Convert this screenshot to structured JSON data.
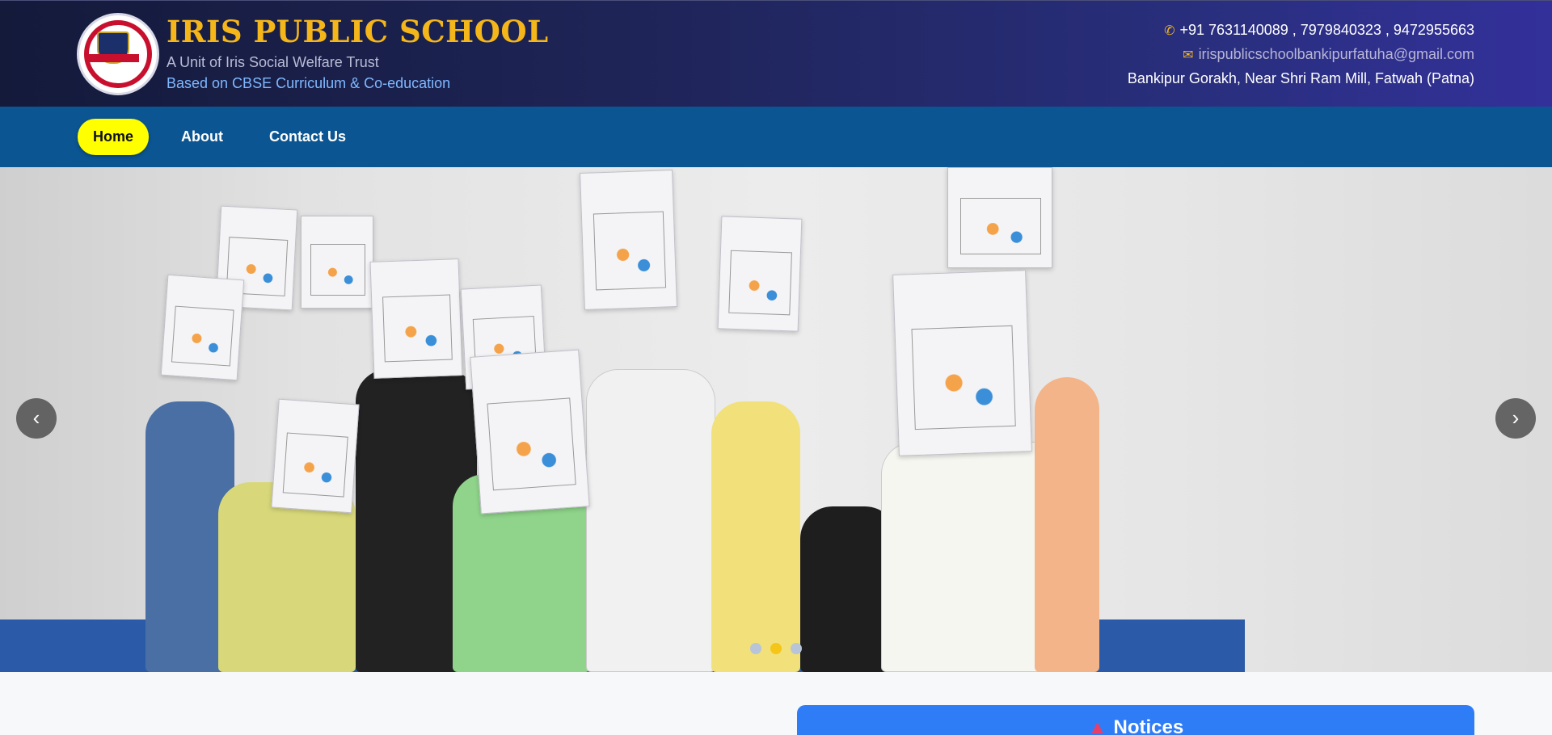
{
  "header": {
    "school_name": "IRIS PUBLIC SCHOOL",
    "subtitle1": "A Unit of Iris Social Welfare Trust",
    "subtitle2": "Based on CBSE Curriculum & Co-education",
    "phone": "+91 7631140089 , 7979840323 , 9472955663",
    "email": "irispublicschoolbankipurfatuha@gmail.com",
    "address": "Bankipur Gorakh, Near Shri Ram Mill, Fatwah (Patna)",
    "phone_icon": "phone-icon",
    "email_icon": "mail-icon"
  },
  "nav": {
    "items": [
      {
        "label": "Home",
        "active": true
      },
      {
        "label": "About"
      },
      {
        "label": "Contact Us"
      }
    ]
  },
  "carousel": {
    "prev_icon": "chevron-left-icon",
    "next_icon": "chevron-right-icon",
    "slides": 3,
    "active_slide": 2,
    "image_alt": "Children holding Holi Hai drawings"
  },
  "notices": {
    "title": "Notices",
    "icon": "megaphone-icon"
  },
  "colors": {
    "accent": "#f5b61a",
    "nav_bg": "#0b5592",
    "active_nav": "#ffff00",
    "notices_bg": "#2f7df6"
  }
}
